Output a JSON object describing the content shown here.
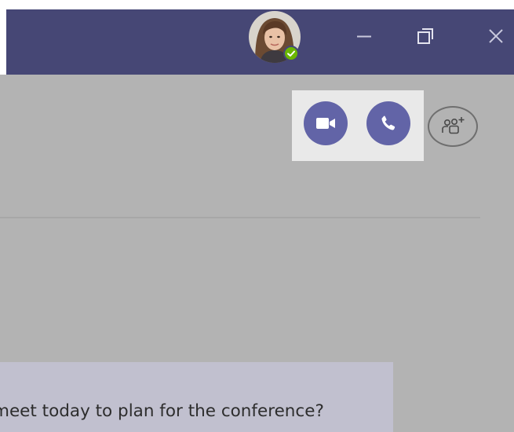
{
  "title_bar": {
    "background_color": "#464775",
    "avatar": {
      "presence": "available",
      "presence_color": "#6bb700"
    },
    "window_controls": {
      "minimize_icon": "minimize-icon",
      "restore_icon": "restore-icon",
      "close_icon": "close-icon"
    }
  },
  "call_controls": {
    "accent_color": "#6264a7",
    "highlight_color": "#e9e9e9",
    "video_call_icon": "video-camera-icon",
    "audio_call_icon": "phone-icon",
    "add_people_icon": "add-people-icon"
  },
  "chat": {
    "message_background": "#c1c0cf",
    "message_text": "meet today to plan for the conference?"
  }
}
